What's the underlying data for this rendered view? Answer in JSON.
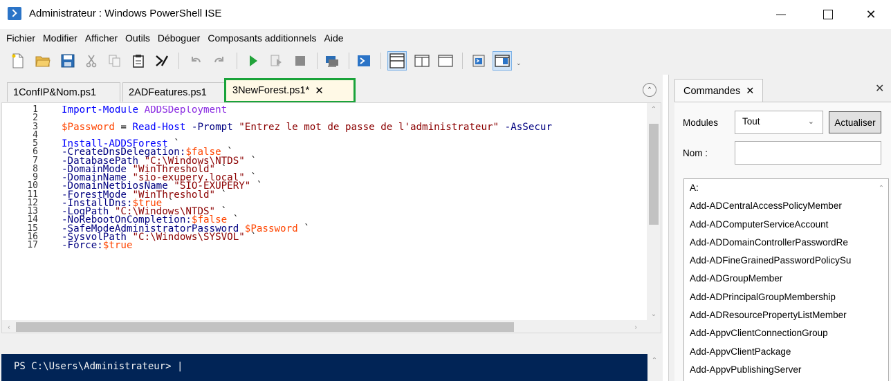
{
  "window": {
    "title": "Administrateur : Windows PowerShell ISE",
    "minimize_glyph": "",
    "close_glyph": "✕"
  },
  "menu": [
    "Fichier",
    "Modifier",
    "Afficher",
    "Outils",
    "Déboguer",
    "Composants additionnels",
    "Aide"
  ],
  "colors": {
    "console_bg": "#012456",
    "active_tab_border": "#1aa33a",
    "cmdlet": "#0000ff",
    "parameter": "#000080",
    "variable": "#ff4500",
    "string": "#8b0000"
  },
  "tabs": [
    {
      "label": "1ConfIP&Nom.ps1"
    },
    {
      "label": "2ADFeatures.ps1"
    },
    {
      "label": "3NewForest.ps1*",
      "active": true,
      "close": "✕"
    }
  ],
  "editor": {
    "line_numbers": [
      "1",
      "2",
      "3",
      "4",
      "5",
      "6",
      "7",
      "8",
      "9",
      "10",
      "11",
      "12",
      "13",
      "14",
      "15",
      "16",
      "17"
    ],
    "lines": [
      [
        {
          "t": "Import-Module",
          "c": "cmd"
        },
        {
          "t": " ",
          "c": "plain"
        },
        {
          "t": "ADDSDeployment",
          "c": "purple"
        }
      ],
      [],
      [
        {
          "t": "$Password",
          "c": "var"
        },
        {
          "t": " = ",
          "c": "plain"
        },
        {
          "t": "Read-Host",
          "c": "cmd"
        },
        {
          "t": " ",
          "c": "plain"
        },
        {
          "t": "-Prompt",
          "c": "param"
        },
        {
          "t": " ",
          "c": "plain"
        },
        {
          "t": "\"Entrez le mot de passe de l'administrateur\"",
          "c": "str"
        },
        {
          "t": " ",
          "c": "plain"
        },
        {
          "t": "-AsSecur",
          "c": "param"
        }
      ],
      [],
      [
        {
          "t": "Install-ADDSForest",
          "c": "cmd"
        },
        {
          "t": " `",
          "c": "plain"
        }
      ],
      [
        {
          "t": "-CreateDnsDelegation:",
          "c": "param"
        },
        {
          "t": "$false",
          "c": "var"
        },
        {
          "t": " `",
          "c": "plain"
        }
      ],
      [
        {
          "t": "-DatabasePath",
          "c": "param"
        },
        {
          "t": " ",
          "c": "plain"
        },
        {
          "t": "\"C:\\Windows\\NTDS\"",
          "c": "str"
        },
        {
          "t": " `",
          "c": "plain"
        }
      ],
      [
        {
          "t": "-DomainMode",
          "c": "param"
        },
        {
          "t": " ",
          "c": "plain"
        },
        {
          "t": "\"WinThreshold\"",
          "c": "str"
        },
        {
          "t": " `",
          "c": "plain"
        }
      ],
      [
        {
          "t": "-DomainName",
          "c": "param"
        },
        {
          "t": " ",
          "c": "plain"
        },
        {
          "t": "\"sio-exupery.local\"",
          "c": "str"
        },
        {
          "t": " `",
          "c": "plain"
        }
      ],
      [
        {
          "t": "-DomainNetbiosName",
          "c": "param"
        },
        {
          "t": " ",
          "c": "plain"
        },
        {
          "t": "\"SIO-EXUPERY\"",
          "c": "str"
        },
        {
          "t": " `",
          "c": "plain"
        }
      ],
      [
        {
          "t": "-ForestMode",
          "c": "param"
        },
        {
          "t": " ",
          "c": "plain"
        },
        {
          "t": "\"WinThreshold\"",
          "c": "str"
        },
        {
          "t": " `",
          "c": "plain"
        }
      ],
      [
        {
          "t": "-InstallDns:",
          "c": "param"
        },
        {
          "t": "$true",
          "c": "var"
        },
        {
          "t": " `",
          "c": "plain"
        }
      ],
      [
        {
          "t": "-LogPath",
          "c": "param"
        },
        {
          "t": " ",
          "c": "plain"
        },
        {
          "t": "\"C:\\Windows\\NTDS\"",
          "c": "str"
        },
        {
          "t": " `",
          "c": "plain"
        }
      ],
      [
        {
          "t": "-NoRebootOnCompletion:",
          "c": "param"
        },
        {
          "t": "$false",
          "c": "var"
        },
        {
          "t": " `",
          "c": "plain"
        }
      ],
      [
        {
          "t": "-SafeModeAdministratorPassword",
          "c": "param"
        },
        {
          "t": " ",
          "c": "plain"
        },
        {
          "t": "$Password",
          "c": "var"
        },
        {
          "t": " `",
          "c": "plain"
        }
      ],
      [
        {
          "t": "-SysvolPath",
          "c": "param"
        },
        {
          "t": " ",
          "c": "plain"
        },
        {
          "t": "\"C:\\Windows\\SYSVOL\"",
          "c": "str"
        },
        {
          "t": " `",
          "c": "plain"
        }
      ],
      [
        {
          "t": "-Force:",
          "c": "param"
        },
        {
          "t": "$true",
          "c": "var"
        }
      ]
    ]
  },
  "console": {
    "prompt": "PS C:\\Users\\Administrateur> |"
  },
  "commands_pane": {
    "tab_label": "Commandes",
    "tab_close": "✕",
    "pane_close": "✕",
    "modules_label": "Modules",
    "modules_selected": "Tout",
    "refresh_label": "Actualiser",
    "name_label": "Nom :",
    "name_value": "",
    "items": [
      "A:",
      "Add-ADCentralAccessPolicyMember",
      "Add-ADComputerServiceAccount",
      "Add-ADDomainControllerPasswordRe",
      "Add-ADFineGrainedPasswordPolicySu",
      "Add-ADGroupMember",
      "Add-ADPrincipalGroupMembership",
      "Add-ADResourcePropertyListMember",
      "Add-AppvClientConnectionGroup",
      "Add-AppvClientPackage",
      "Add-AppvPublishingServer"
    ]
  },
  "toolbar_icons": [
    "new-file-icon",
    "open-folder-icon",
    "save-icon",
    "cut-icon",
    "copy-icon",
    "paste-icon",
    "powershell-icon",
    "undo-icon",
    "redo-icon",
    "run-icon",
    "run-selection-icon",
    "stop-icon",
    "remote-powershell-icon",
    "powershell-console-icon",
    "layout-top-icon",
    "layout-right-icon",
    "layout-maximized-icon",
    "show-commands-icon",
    "show-script-pane-icon"
  ]
}
